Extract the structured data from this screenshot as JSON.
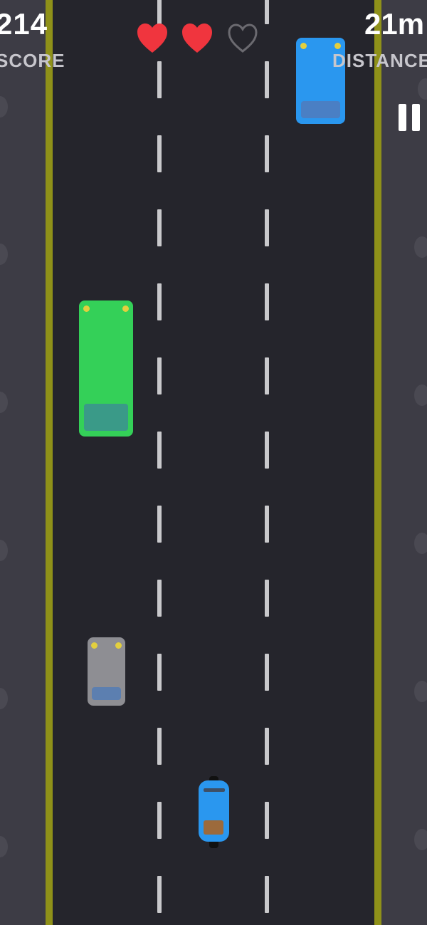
{
  "hud": {
    "score_value": "214",
    "score_label": "SCORE",
    "distance_value": "21m",
    "distance_label": "DISTANCE",
    "lives_total": 3,
    "lives_remaining": 2,
    "heart_full_color": "#f0353e",
    "heart_empty_color": "#6b6a70"
  },
  "colors": {
    "road": "#25252c",
    "shoulder": "#3d3c45",
    "edge_line": "#8f9119",
    "lane_dash": "#c9c9cc",
    "headlight": "#e3cf3e"
  },
  "vehicles": [
    {
      "name": "blue-car",
      "lane": "right",
      "color": "#2a97ef",
      "window_color": "#4a7fc4"
    },
    {
      "name": "green-bus",
      "lane": "left",
      "color": "#34d058",
      "window_color": "#3a9a88"
    },
    {
      "name": "gray-car",
      "lane": "left",
      "color": "#8e8e93",
      "window_color": "#5c7fb0"
    }
  ],
  "player": {
    "vehicle": "motorcycle",
    "color": "#2a97ef",
    "seat_color": "#9c6a3c"
  },
  "controls": {
    "pause_icon": "pause-icon"
  }
}
